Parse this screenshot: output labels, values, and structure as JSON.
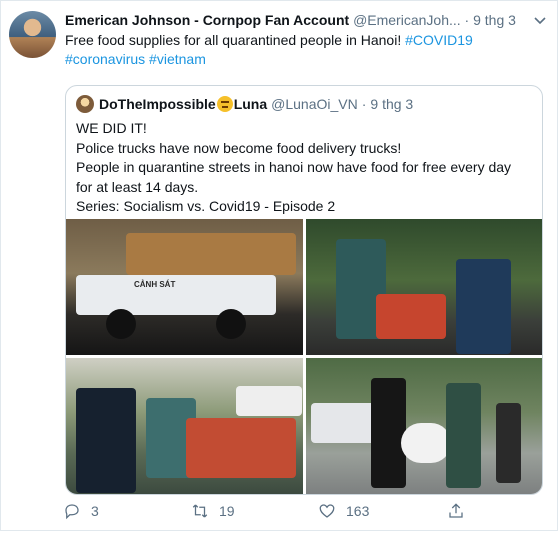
{
  "tweet": {
    "author_name": "Emerican Johnson - Cornpop Fan Account",
    "author_handle": "@EmericanJoh...",
    "dot": "·",
    "date": "9 thg 3",
    "text_plain": "Free food supplies for all quarantined people in Hanoi! ",
    "hashtags": [
      "#COVID19",
      "#coronavirus",
      "#vietnam"
    ]
  },
  "quoted": {
    "author_name": "DoTheImpossible",
    "author_name_suffix": "Luna",
    "author_handle": "@LunaOi_VN",
    "dot": "·",
    "date": "9 thg 3",
    "lines": [
      "WE DID IT!",
      "Police trucks have now become food delivery trucks!",
      "People in quarantine streets in hanoi now have food for free every day",
      "for at least 14 days.",
      "Series: Socialism vs. Covid19 - Episode 2"
    ]
  },
  "photos": {
    "truck_sign": "CẢNH SÁT"
  },
  "actions": {
    "replies": "3",
    "retweets": "19",
    "likes": "163"
  },
  "icons": {
    "reply": "reply-icon",
    "retweet": "retweet-icon",
    "like": "heart-icon",
    "share": "share-icon",
    "more": "chevron-down-icon"
  },
  "colors": {
    "link": "#1b95e0",
    "muted": "#5b7083",
    "border": "#ccd6dd"
  }
}
